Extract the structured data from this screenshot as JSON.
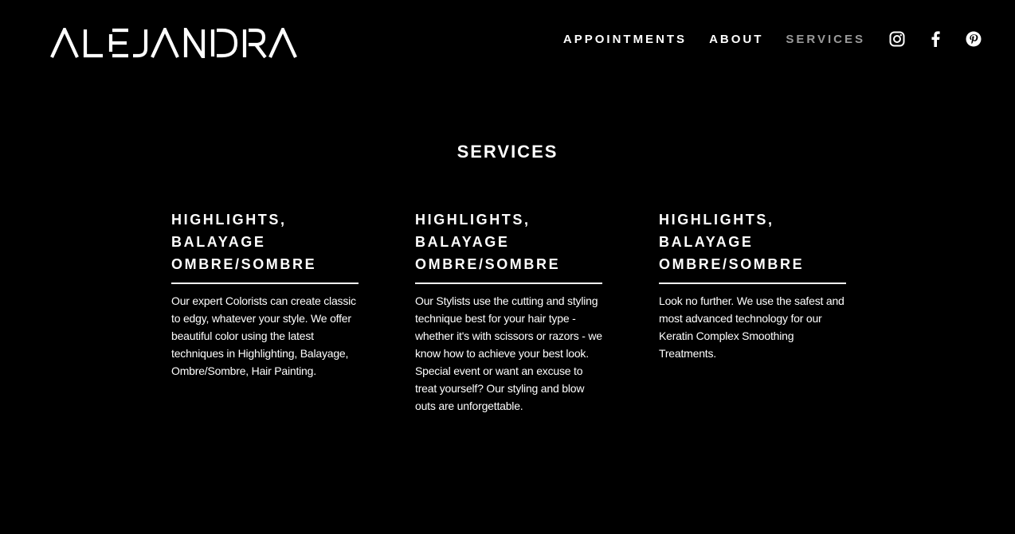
{
  "brand": {
    "logo_text": "ALEJANDRA"
  },
  "nav": {
    "links": [
      {
        "label": "APPOINTMENTS",
        "active": false
      },
      {
        "label": "ABOUT",
        "active": false
      },
      {
        "label": "SERVICES",
        "active": true
      }
    ],
    "social": [
      "instagram-icon",
      "facebook-icon",
      "pinterest-icon"
    ]
  },
  "colors": {
    "background": "#000000",
    "text": "#ffffff",
    "active_nav": "#9a9a9a"
  },
  "main": {
    "title": "SERVICES",
    "services": [
      {
        "heading_lines": [
          "HIGHLIGHTS,",
          "BALAYAGE",
          "OMBRE/SOMBRE"
        ],
        "description": "Our expert Colorists can create classic to edgy, whatever your style. We offer beautiful color using the latest techniques in Highlighting, Balayage, Ombre/Sombre, Hair Painting."
      },
      {
        "heading_lines": [
          "HIGHLIGHTS,",
          "BALAYAGE",
          "OMBRE/SOMBRE"
        ],
        "description": "Our Stylists use the cutting and styling technique best for your hair type - whether it's with scissors or razors - we know how to achieve your best look. Special event or want an excuse to treat yourself? Our styling and blow outs are unforgettable."
      },
      {
        "heading_lines": [
          "HIGHLIGHTS,",
          "BALAYAGE",
          "OMBRE/SOMBRE"
        ],
        "description": "Look no further. We use the safest and most advanced technology for our Keratin Complex Smoothing Treatments."
      }
    ]
  }
}
